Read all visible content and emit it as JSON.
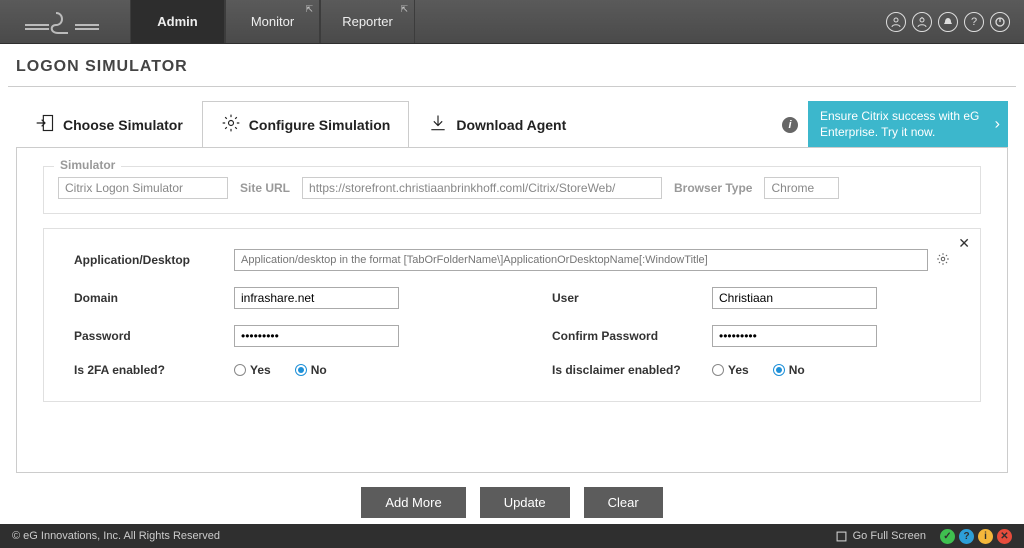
{
  "nav": {
    "admin": "Admin",
    "monitor": "Monitor",
    "reporter": "Reporter"
  },
  "page_title": "LOGON SIMULATOR",
  "steps": {
    "choose": "Choose Simulator",
    "configure": "Configure Simulation",
    "download": "Download Agent"
  },
  "promo": "Ensure Citrix success with eG Enterprise. Try it now.",
  "sim": {
    "legend": "Simulator",
    "name": "Citrix Logon Simulator",
    "site_url_label": "Site URL",
    "site_url": "https://storefront.christiaanbrinkhoff.coml/Citrix/StoreWeb/",
    "browser_label": "Browser Type",
    "browser": "Chrome"
  },
  "fields": {
    "app_label": "Application/Desktop",
    "app_placeholder": "Application/desktop in the format [TabOrFolderName\\]ApplicationOrDesktopName[:WindowTitle]",
    "domain_label": "Domain",
    "domain_value": "infrashare.net",
    "user_label": "User",
    "user_value": "Christiaan",
    "password_label": "Password",
    "password_value": "•••••••••",
    "confirm_label": "Confirm Password",
    "confirm_value": "•••••••••",
    "twofa_label": "Is 2FA enabled?",
    "disclaimer_label": "Is disclaimer enabled?",
    "yes": "Yes",
    "no": "No"
  },
  "buttons": {
    "add": "Add More",
    "update": "Update",
    "clear": "Clear"
  },
  "footer": {
    "copyright": "© eG Innovations, Inc. All Rights Reserved",
    "fullscreen": "Go Full Screen"
  }
}
